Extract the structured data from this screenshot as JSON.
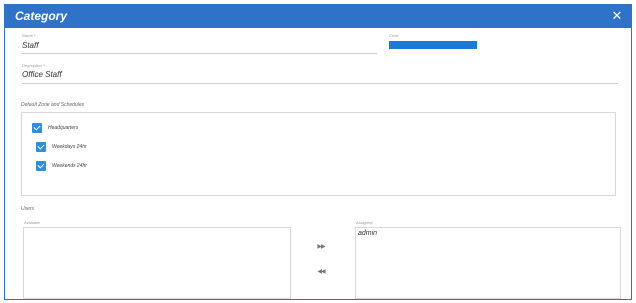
{
  "dialog": {
    "title": "Category",
    "close_glyph": "✕"
  },
  "fields": {
    "name": {
      "label": "Name *",
      "value": "Staff"
    },
    "color": {
      "label": "Color",
      "value_hex": "#1a7ad4"
    },
    "description": {
      "label": "Description *",
      "value": "Office Staff"
    }
  },
  "zones": {
    "section_title": "Default Zone and Schedules",
    "items": [
      {
        "label": "Headquarters",
        "checked": true
      },
      {
        "label": "Weekdays 24hr",
        "checked": true
      },
      {
        "label": "Weekends 24hr",
        "checked": true
      }
    ]
  },
  "users": {
    "section_title": "Users",
    "available_label": "Available",
    "assigned_label": "Assigned",
    "available_items": [],
    "assigned_items": [
      "admin"
    ],
    "move_right_glyph": "▶▶",
    "move_left_glyph": "◀◀"
  },
  "colors": {
    "accent": "#2e73c8",
    "checkbox": "#2f8fdc",
    "swatch": "#1a7ad4"
  }
}
